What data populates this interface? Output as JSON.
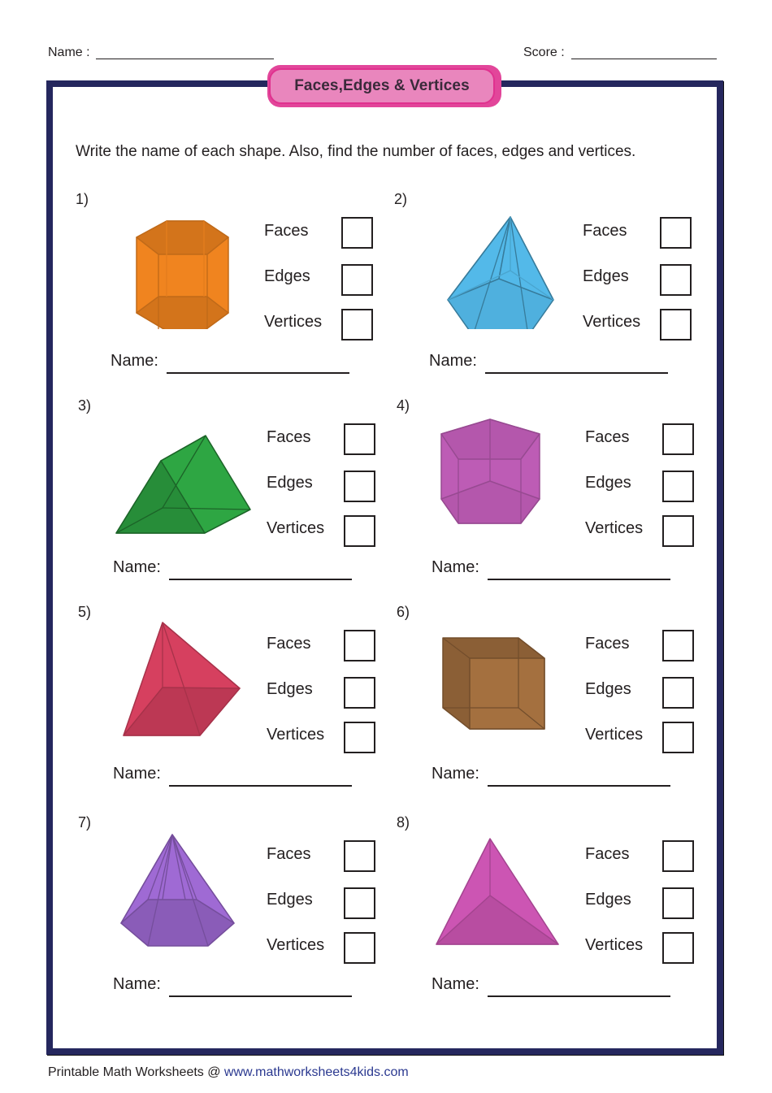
{
  "header": {
    "name_label": "Name :",
    "score_label": "Score :"
  },
  "title": "Faces,Edges & Vertices",
  "instructions": "Write the name of each shape. Also, find the number of faces, edges and vertices.",
  "field_labels": {
    "faces": "Faces",
    "edges": "Edges",
    "vertices": "Vertices",
    "name": "Name:"
  },
  "problems": [
    {
      "number": "1)",
      "shape": "hexagonal-prism",
      "color": "#f0841f"
    },
    {
      "number": "2)",
      "shape": "pentagonal-pyramid",
      "color": "#4fb0de"
    },
    {
      "number": "3)",
      "shape": "triangular-prism",
      "color": "#2ea643"
    },
    {
      "number": "4)",
      "shape": "pentagonal-prism",
      "color": "#bd5cb5"
    },
    {
      "number": "5)",
      "shape": "square-pyramid",
      "color": "#d6405f"
    },
    {
      "number": "6)",
      "shape": "cube",
      "color": "#a4703f"
    },
    {
      "number": "7)",
      "shape": "hexagonal-pyramid",
      "color": "#8a5cb8"
    },
    {
      "number": "8)",
      "shape": "triangular-pyramid",
      "color": "#cc55b3"
    }
  ],
  "footer": {
    "text": "Printable Math Worksheets @ ",
    "link": "www.mathworksheets4kids.com"
  },
  "colors": {
    "frame": "#25275e",
    "title_bg": "#e986bd",
    "title_border": "#e0318f",
    "link": "#2b3990"
  }
}
